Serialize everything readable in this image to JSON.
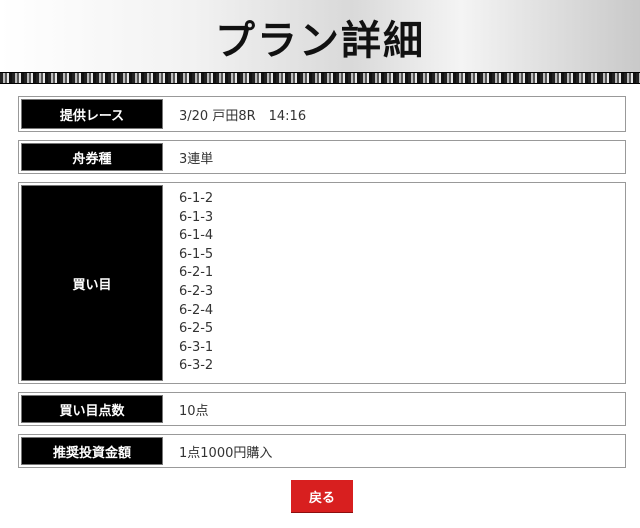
{
  "header": {
    "title": "プラン詳細"
  },
  "plan": {
    "race": {
      "label": "提供レース",
      "value": "3/20 戸田8R　14:16"
    },
    "ticket_type": {
      "label": "舟券種",
      "value": "3連単"
    },
    "picks": {
      "label": "買い目",
      "items": [
        "6-1-2",
        "6-1-3",
        "6-1-4",
        "6-1-5",
        "6-2-1",
        "6-2-3",
        "6-2-4",
        "6-2-5",
        "6-3-1",
        "6-3-2"
      ]
    },
    "pick_count": {
      "label": "買い目点数",
      "value": "10点"
    },
    "stake": {
      "label": "推奨投資金額",
      "value": "1点1000円購入"
    }
  },
  "actions": {
    "back_label": "戻る"
  },
  "colors": {
    "label_bg": "#000000",
    "button_bg": "#d81f1f"
  }
}
